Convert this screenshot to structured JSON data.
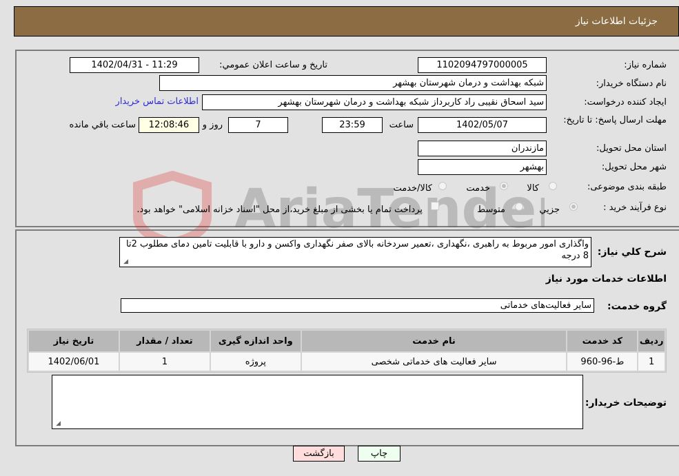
{
  "header": {
    "title": "جزئیات اطلاعات نیاز"
  },
  "fields": {
    "need_number": {
      "label": "شماره نیاز:",
      "value": "1102094797000005"
    },
    "announce_datetime": {
      "label": "تاریخ و ساعت اعلان عمومي:",
      "value": "1402/04/31 - 11:29"
    },
    "buyer_org": {
      "label": "نام دستگاه خریدار:",
      "value": "شبکه بهداشت و درمان شهرستان بهشهر"
    },
    "requester": {
      "label": "ایجاد کننده درخواست:",
      "value": "سید اسحاق نقیبی راد کاربرداز شبکه بهداشت و درمان شهرستان بهشهر",
      "contact_link": "اطلاعات تماس خریدار"
    },
    "deadline": {
      "label": "مهلت ارسال پاسخ: تا تاریخ:",
      "date": "1402/05/07",
      "time_label": "ساعت",
      "time": "23:59",
      "days": "7",
      "days_label": "روز و",
      "remaining": "12:08:46",
      "remaining_label": "ساعت باقي مانده"
    },
    "province": {
      "label": "استان محل تحویل:",
      "value": "مازندران"
    },
    "city": {
      "label": "شهر محل تحویل:",
      "value": "بهشهر"
    },
    "category": {
      "label": "طبقه بندی موضوعی:",
      "options": [
        "کالا",
        "خدمت",
        "کالا/خدمت"
      ],
      "selected": "خدمت"
    },
    "process_type": {
      "label": "نوع فرآیند خرید :",
      "options": [
        "جزيي",
        "متوسط"
      ],
      "selected": "جزيي",
      "treasury_note": "پرداخت تمام یا بخشی از مبلغ خرید،از محل \"اسناد خزانه اسلامی\" خواهد بود."
    },
    "description": {
      "label": "شرح كلي نياز:",
      "value": "واگذاری امور مربوط به راهبری ،نگهداری ،تعمیر سردخانه بالای صفر نگهداری واکسن  و دارو با قابلیت تامین دمای مطلوب 2تا 8 درجه"
    }
  },
  "services": {
    "section_title": "اطلاعات خدمات مورد نیاز",
    "group_label": "گروه خدمت:",
    "group_value": "سایر فعالیت‌های خدماتی",
    "columns": [
      "ردیف",
      "کد خدمت",
      "نام خدمت",
      "واحد اندازه گیری",
      "تعداد / مقدار",
      "تاریخ نیاز"
    ],
    "rows": [
      [
        "1",
        "ط-96-960",
        "سایر فعالیت های خدماتی شخصی",
        "پروژه",
        "1",
        "1402/06/01"
      ]
    ]
  },
  "buyer_notes": {
    "label": "توضیحات خریدار:",
    "value": ""
  },
  "buttons": {
    "print": "چاپ",
    "back": "بازگشت"
  },
  "watermark": {
    "text": "AriaTender.neT"
  },
  "colors": {
    "header_bg": "#8c6d43",
    "link": "#2b2bd8",
    "print_bg": "#efffef",
    "back_bg": "#ffdddd",
    "remaining_bg": "#ffffe6"
  }
}
